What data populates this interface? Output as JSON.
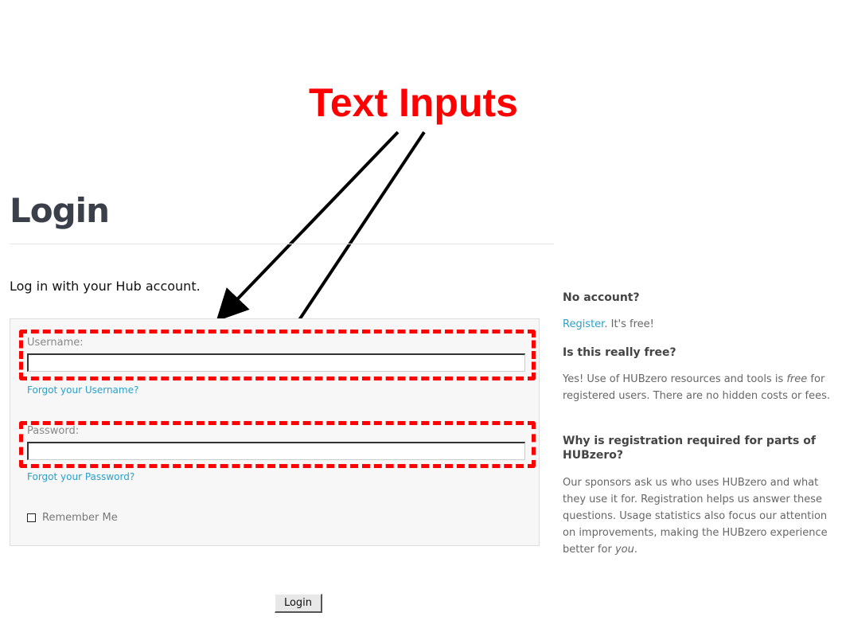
{
  "annotation": {
    "title": "Text Inputs",
    "color": "#ff0000"
  },
  "page": {
    "title": "Login",
    "subheading": "Log in with your Hub account."
  },
  "form": {
    "username_label": "Username:",
    "username_value": "",
    "forgot_username": "Forgot your Username?",
    "password_label": "Password:",
    "password_value": "",
    "forgot_password": "Forgot your Password?",
    "remember_me": "Remember Me",
    "remember_checked": false,
    "login_button": "Login"
  },
  "sidebar": {
    "no_account_heading": "No account?",
    "register_link": "Register",
    "register_suffix": ". It's free!",
    "free_heading": "Is this really free?",
    "free_text_before": "Yes! Use of HUBzero resources and tools is ",
    "free_text_em": "free",
    "free_text_after": " for registered users. There are no hidden costs or fees.",
    "why_heading": "Why is registration required for parts of HUBzero?",
    "why_text_before": "Our sponsors ask us who uses HUBzero and what they use it for. Registration helps us answer these questions. Usage statistics also focus our attention on improvements, making the HUBzero experience better for ",
    "why_text_em": "you",
    "why_text_after": "."
  },
  "colors": {
    "link": "#2ba0c9",
    "title": "#3b3f4a",
    "highlight": "#ff0000"
  }
}
